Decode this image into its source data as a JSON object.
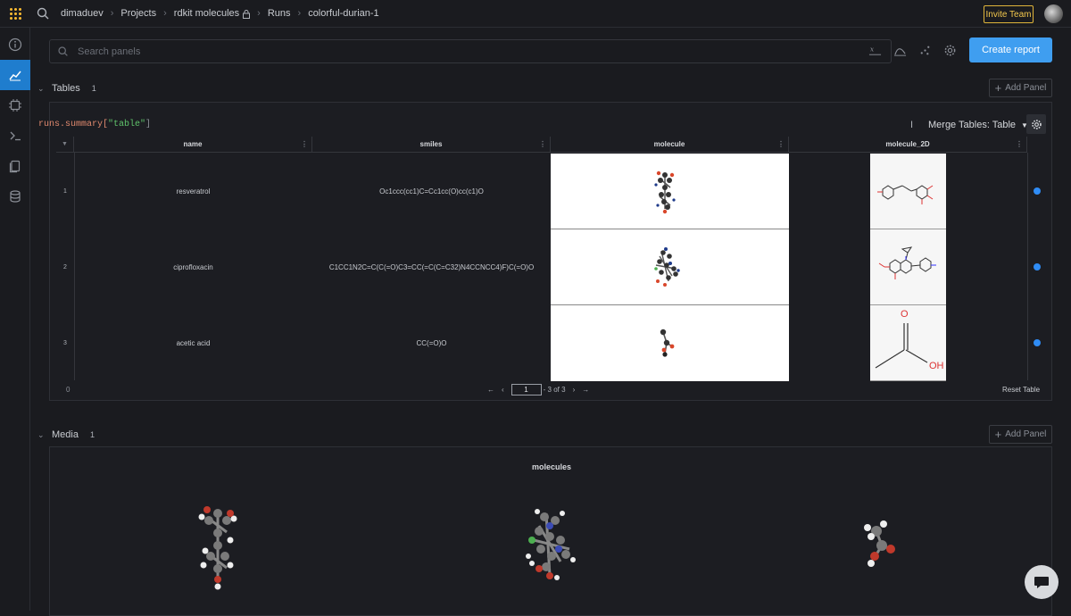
{
  "breadcrumb": [
    "dimaduev",
    "Projects",
    "rdkit molecules",
    "Runs",
    "colorful-durian-1"
  ],
  "header": {
    "invite_label": "Invite Team"
  },
  "search": {
    "placeholder": "Search panels"
  },
  "toolbar": {
    "create_report_label": "Create report"
  },
  "sections": {
    "tables": {
      "title": "Tables",
      "count": "1",
      "add_panel_label": "Add Panel"
    },
    "media": {
      "title": "Media",
      "count": "1",
      "add_panel_label": "Add Panel"
    }
  },
  "table_panel": {
    "query_prefix": "runs.summary[",
    "query_key": "\"table\"",
    "query_suffix": "]",
    "merge_label": "Merge Tables: Table",
    "columns": [
      "name",
      "smiles",
      "molecule",
      "molecule_2D"
    ],
    "rows": [
      {
        "index": "1",
        "name": "resveratrol",
        "smiles": "Oc1ccc(cc1)C=Cc1cc(O)cc(c1)O"
      },
      {
        "index": "2",
        "name": "ciprofloxacin",
        "smiles": "C1CC1N2C=C(C(=O)C3=CC(=C(C=C32)N4CCNCC4)F)C(=O)O"
      },
      {
        "index": "3",
        "name": "acetic acid",
        "smiles": "CC(=O)O"
      }
    ],
    "footer_count": "0",
    "page_value": "1",
    "page_of": "- 3 of 3",
    "reset_label": "Reset Table",
    "mol2d_labels": {
      "o_top": "O",
      "oh": "OH"
    }
  },
  "media_panel": {
    "title": "molecules"
  },
  "icons": [
    "search-icon",
    "info-icon",
    "chart-icon",
    "chip-icon",
    "terminal-icon",
    "file-icon",
    "database-icon",
    "lock-icon",
    "gear-icon",
    "chat-icon"
  ],
  "colors": {
    "accent": "#3f9ef0",
    "invite": "#f3c84d",
    "active_nav": "#1f7dce",
    "status_dot": "#2f8cf5"
  }
}
